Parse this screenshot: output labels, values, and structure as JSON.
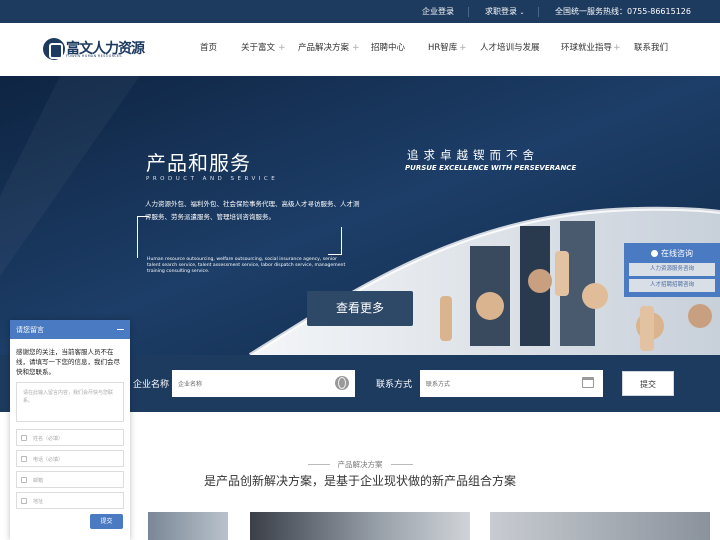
{
  "topbar": {
    "enterprise_login": "企业登录",
    "job_login": "求职登录",
    "hotline": "全国统一服务热线：0755-86615126"
  },
  "brand": {
    "name": "富文人力资源",
    "sub": "FUWEN HUMAN RESOURCES"
  },
  "nav": {
    "home": "首页",
    "about": "关于富文",
    "solutions": "产品解决方案",
    "recruit": "招聘中心",
    "hr_lib": "HR智库",
    "training": "人才培训与发展",
    "global": "环球就业指导",
    "contact": "联系我们"
  },
  "hero": {
    "title": "产品和服务",
    "subtitle": "PRODUCT AND SERVICE",
    "desc_cn": "人力资源外包、福利外包、社会保险事务代理、高级人才寻访服务、人才测评服务、劳务派遣服务、管理培训咨询服务。",
    "desc_en": "Human resource outsourcing, welfare outsourcing, social insurance agency, senior talent search service, talent assessment service, labor dispatch service, management training consulting service.",
    "slogan": "追求卓越锲而不舍",
    "slogan_en": "PURSUE EXCELLENCE WITH PERSEVERANCE",
    "more_button": "查看更多"
  },
  "form": {
    "company_label": "企业名称",
    "company_placeholder": "企业名称",
    "contact_label": "联系方式",
    "contact_placeholder": "联系方式",
    "submit": "提交"
  },
  "section": {
    "small_title": "产品解决方案",
    "title": "是产品创新解决方案，是基于企业现状做的新产品组合方案"
  },
  "float": {
    "title": "在线咨询",
    "btn1": "人力资源服务咨询",
    "btn2": "人才招聘招聘咨询"
  },
  "chat": {
    "title": "请您留言",
    "message": "感谢您的关注，当前客服人员不在线，请填写一下您的信息，我们会尽快和您联系。",
    "content_placeholder": "请在此输入留言内容，我们会尽快与您联系。",
    "name_placeholder": "姓名（必填）",
    "phone_placeholder": "电话（必填）",
    "email_placeholder": "邮箱",
    "address_placeholder": "地址",
    "submit": "提交"
  },
  "colors": {
    "primary": "#1d3a5f",
    "accent": "#4a7ac1"
  }
}
